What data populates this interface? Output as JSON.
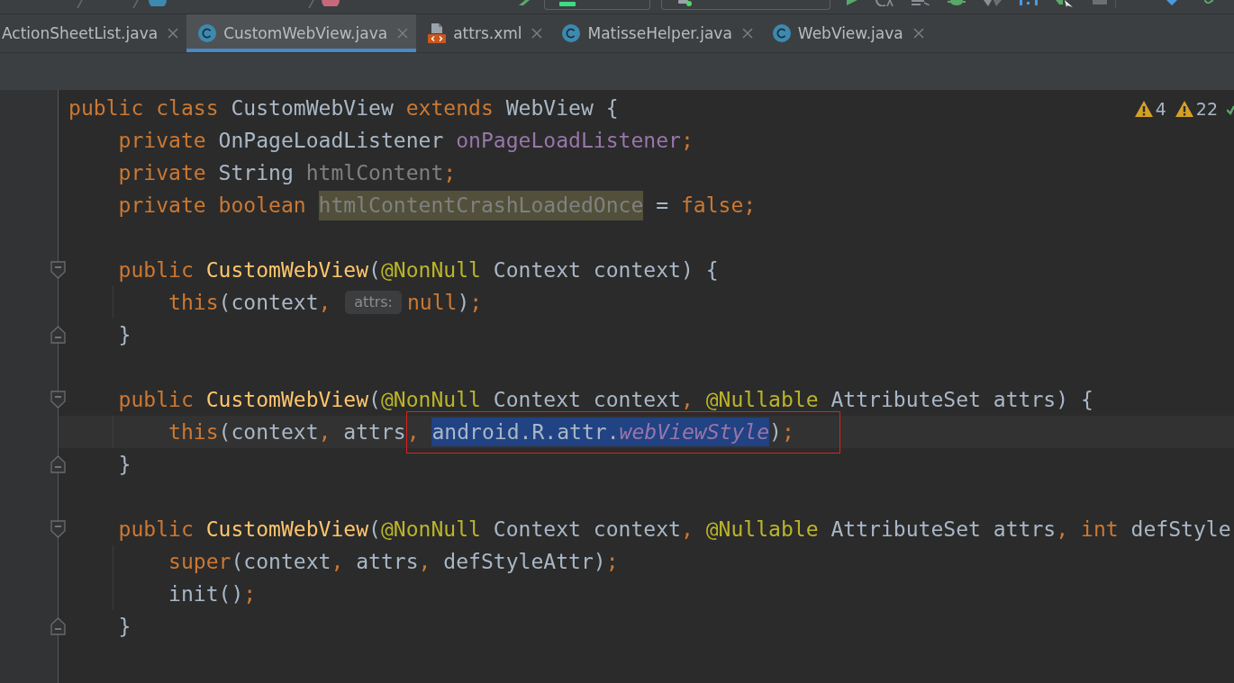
{
  "tabs": [
    {
      "label": "ActionSheetList.java",
      "selected": false
    },
    {
      "label": "CustomWebView.java",
      "kind": "class",
      "selected": true
    },
    {
      "label": "attrs.xml",
      "kind": "xml",
      "selected": false
    },
    {
      "label": "MatisseHelper.java",
      "kind": "class",
      "selected": false
    },
    {
      "label": "WebView.java",
      "kind": "class",
      "selected": false
    }
  ],
  "editor": {
    "inspections": [
      {
        "count": "4"
      },
      {
        "count": "22"
      }
    ],
    "lines": [
      {
        "kind": "code",
        "segments": [
          {
            "kind": "code",
            "tokens": [
              {
                "text": "public class ",
                "kind": "keyword"
              },
              {
                "text": "CustomWebView ",
                "kind": "plain"
              },
              {
                "text": "extends ",
                "kind": "keyword"
              },
              {
                "text": "WebView {",
                "kind": "plain"
              }
            ]
          }
        ],
        "blocks": [
          {
            "lines": [
              {
                "kind": "code",
                "segments": [
                  {
                    "kind": "code",
                    "tokens": [
                      {
                        "text": "private ",
                        "kind": "keyword"
                      },
                      {
                        "text": "OnPageLoadListener ",
                        "kind": "plain"
                      },
                      {
                        "text": "onPageLoadListener",
                        "kind": "field"
                      },
                      {
                        "text": ";",
                        "kind": "keyword"
                      }
                    ]
                  }
                ]
              },
              {
                "kind": "code",
                "segments": [
                  {
                    "kind": "code",
                    "tokens": [
                      {
                        "text": "private ",
                        "kind": "keyword"
                      },
                      {
                        "text": "String ",
                        "kind": "plain"
                      },
                      {
                        "text": "htmlContent",
                        "kind": "unused"
                      },
                      {
                        "text": ";",
                        "kind": "keyword"
                      }
                    ]
                  }
                ]
              },
              {
                "kind": "code",
                "segments": [
                  {
                    "kind": "code",
                    "tokens": [
                      {
                        "text": "private boolean ",
                        "kind": "keyword"
                      }
                    ]
                  },
                  {
                    "kind": "usage_highlight",
                    "tokens": [
                      {
                        "text": "htmlContentCrashLoadedOnce",
                        "kind": "unused"
                      }
                    ]
                  },
                  {
                    "kind": "code",
                    "tokens": [
                      {
                        "text": " = ",
                        "kind": "plain"
                      },
                      {
                        "text": "false;",
                        "kind": "keyword"
                      }
                    ]
                  }
                ]
              }
            ]
          },
          {
            "lines": [
              {
                "kind": "fold_start",
                "segments": [
                  {
                    "kind": "code",
                    "tokens": [
                      {
                        "text": "public ",
                        "kind": "keyword"
                      },
                      {
                        "text": "CustomWebView",
                        "kind": "method"
                      },
                      {
                        "text": "(",
                        "kind": "plain"
                      },
                      {
                        "text": "@NonNull",
                        "kind": "annotation"
                      },
                      {
                        "text": " Context context) {",
                        "kind": "plain"
                      }
                    ]
                  }
                ],
                "children": [
                  {
                    "kind": "code",
                    "segments": [
                      {
                        "kind": "code",
                        "tokens": [
                          {
                            "text": "this",
                            "kind": "keyword"
                          },
                          {
                            "text": "(context",
                            "kind": "plain"
                          },
                          {
                            "text": ", ",
                            "kind": "keyword"
                          }
                        ]
                      },
                      {
                        "kind": "hint",
                        "text": "attrs:"
                      },
                      {
                        "kind": "code",
                        "tokens": [
                          {
                            "text": "null",
                            "kind": "keyword"
                          },
                          {
                            "text": ")",
                            "kind": "plain"
                          },
                          {
                            "text": ";",
                            "kind": "keyword"
                          }
                        ]
                      }
                    ]
                  }
                ]
              },
              {
                "kind": "fold_end",
                "segments": [
                  {
                    "kind": "code",
                    "tokens": [
                      {
                        "text": "}",
                        "kind": "plain"
                      }
                    ]
                  }
                ]
              }
            ]
          },
          {
            "lines": [
              {
                "kind": "fold_start",
                "segments": [
                  {
                    "kind": "code",
                    "tokens": [
                      {
                        "text": "public ",
                        "kind": "keyword"
                      },
                      {
                        "text": "CustomWebView",
                        "kind": "method"
                      },
                      {
                        "text": "(",
                        "kind": "plain"
                      },
                      {
                        "text": "@NonNull",
                        "kind": "annotation"
                      },
                      {
                        "text": " Context context",
                        "kind": "plain"
                      },
                      {
                        "text": ", ",
                        "kind": "keyword"
                      },
                      {
                        "text": "@Nullable",
                        "kind": "annotation"
                      },
                      {
                        "text": " AttributeSet attrs) {",
                        "kind": "plain"
                      }
                    ]
                  }
                ],
                "children": [
                  {
                    "kind": "caret_line",
                    "segments": [
                      {
                        "kind": "code",
                        "tokens": [
                          {
                            "text": "this",
                            "kind": "keyword"
                          },
                          {
                            "text": "(context",
                            "kind": "plain"
                          },
                          {
                            "text": ", ",
                            "kind": "keyword"
                          },
                          {
                            "text": "attrs",
                            "kind": "plain"
                          }
                        ]
                      },
                      {
                        "kind": "annotation_box",
                        "segments": [
                          {
                            "kind": "code",
                            "tokens": [
                              {
                                "text": ", ",
                                "kind": "keyword"
                              }
                            ]
                          },
                          {
                            "kind": "selection",
                            "tokens": [
                              {
                                "text": "android.R.attr.",
                                "kind": "plain"
                              },
                              {
                                "text": "webViewStyle",
                                "kind": "static_field"
                              }
                            ]
                          },
                          {
                            "kind": "code",
                            "tokens": [
                              {
                                "text": ")",
                                "kind": "plain"
                              },
                              {
                                "text": ";",
                                "kind": "keyword"
                              }
                            ]
                          }
                        ]
                      }
                    ]
                  }
                ]
              },
              {
                "kind": "fold_end",
                "segments": [
                  {
                    "kind": "code",
                    "tokens": [
                      {
                        "text": "}",
                        "kind": "plain"
                      }
                    ]
                  }
                ]
              }
            ]
          },
          {
            "lines": [
              {
                "kind": "fold_start",
                "segments": [
                  {
                    "kind": "code",
                    "tokens": [
                      {
                        "text": "public ",
                        "kind": "keyword"
                      },
                      {
                        "text": "CustomWebView",
                        "kind": "method"
                      },
                      {
                        "text": "(",
                        "kind": "plain"
                      },
                      {
                        "text": "@NonNull",
                        "kind": "annotation"
                      },
                      {
                        "text": " Context context",
                        "kind": "plain"
                      },
                      {
                        "text": ", ",
                        "kind": "keyword"
                      },
                      {
                        "text": "@Nullable",
                        "kind": "annotation"
                      },
                      {
                        "text": " AttributeSet attrs",
                        "kind": "plain"
                      },
                      {
                        "text": ", ",
                        "kind": "keyword"
                      },
                      {
                        "text": "int ",
                        "kind": "keyword"
                      },
                      {
                        "text": "defStyle",
                        "kind": "plain"
                      }
                    ]
                  }
                ],
                "children": [
                  {
                    "kind": "code",
                    "segments": [
                      {
                        "kind": "code",
                        "tokens": [
                          {
                            "text": "super",
                            "kind": "keyword"
                          },
                          {
                            "text": "(context",
                            "kind": "plain"
                          },
                          {
                            "text": ", ",
                            "kind": "keyword"
                          },
                          {
                            "text": "attrs",
                            "kind": "plain"
                          },
                          {
                            "text": ", ",
                            "kind": "keyword"
                          },
                          {
                            "text": "defStyleAttr)",
                            "kind": "plain"
                          },
                          {
                            "text": ";",
                            "kind": "keyword"
                          }
                        ]
                      }
                    ]
                  },
                  {
                    "kind": "code",
                    "segments": [
                      {
                        "kind": "code",
                        "tokens": [
                          {
                            "text": "init()",
                            "kind": "plain"
                          },
                          {
                            "text": ";",
                            "kind": "keyword"
                          }
                        ]
                      }
                    ]
                  }
                ]
              },
              {
                "kind": "fold_end",
                "segments": [
                  {
                    "kind": "code",
                    "tokens": [
                      {
                        "text": "}",
                        "kind": "plain"
                      }
                    ]
                  }
                ]
              }
            ]
          }
        ]
      }
    ]
  }
}
